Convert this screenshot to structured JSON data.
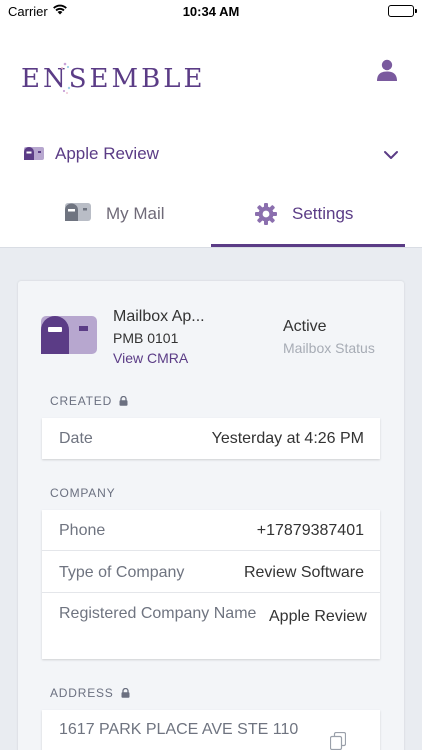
{
  "status_bar": {
    "carrier": "Carrier",
    "time": "10:34 AM"
  },
  "header": {
    "logo_text": "ENSEMBLE",
    "profile_icon": "user-icon"
  },
  "account": {
    "name": "Apple Review",
    "icon": "mailbox-icon",
    "chevron": "chevron-down-icon"
  },
  "tabs": [
    {
      "label": "My Mail",
      "icon": "mailbox-icon",
      "active": false
    },
    {
      "label": "Settings",
      "icon": "gear-icon",
      "active": true
    }
  ],
  "mailbox": {
    "title": "Mailbox Ap...",
    "pmb": "PMB 0101",
    "view_link": "View CMRA",
    "status_value": "Active",
    "status_label": "Mailbox Status"
  },
  "created": {
    "section_label": "CREATED",
    "rows": [
      {
        "key": "Date",
        "value": "Yesterday at 4:26 PM"
      }
    ]
  },
  "company": {
    "section_label": "COMPANY",
    "rows": [
      {
        "key": "Phone",
        "value": "+17879387401"
      },
      {
        "key": "Type of Company",
        "value": "Review Software"
      },
      {
        "key": "Registered Company Name",
        "value": "Apple Review"
      }
    ]
  },
  "address": {
    "section_label": "ADDRESS",
    "line1": "1617 PARK PLACE AVE STE 110"
  },
  "colors": {
    "brand": "#5b3c86",
    "background": "#e9ecf1",
    "card": "#f3f5f8"
  }
}
